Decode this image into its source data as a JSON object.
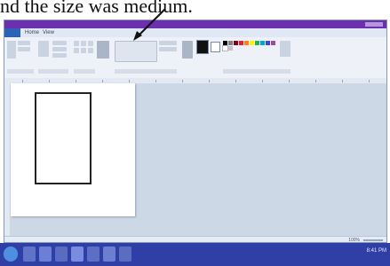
{
  "caption": {
    "text": "nd the size was medium."
  },
  "window": {
    "menu_tabs": [
      "Home",
      "View"
    ]
  },
  "palette_colors": [
    "#000000",
    "#7f7f7f",
    "#880015",
    "#ed1c24",
    "#ff7f27",
    "#fff200",
    "#22b14c",
    "#00a2e8",
    "#3f48cc",
    "#a349a4",
    "#ffffff",
    "#c3c3c3"
  ],
  "statusbar": {
    "zoom": "100%"
  },
  "taskbar": {
    "clock": "8:41 PM",
    "apps": [
      "start",
      "explorer",
      "ie",
      "media",
      "paint",
      "word",
      "excel",
      "folder"
    ]
  }
}
